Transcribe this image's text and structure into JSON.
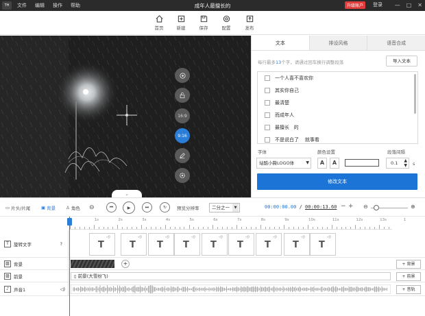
{
  "titlebar": {
    "logo": "TH",
    "menu": [
      "文件",
      "编辑",
      "操作",
      "帮助"
    ],
    "title": "成年人最擅长的",
    "upgrade": "升级账户",
    "login": "登录",
    "window_buttons": [
      "—",
      "□",
      "✕"
    ]
  },
  "toolbar": {
    "items": [
      {
        "label": "首页",
        "icon": "home-icon"
      },
      {
        "label": "新建",
        "icon": "new-file-icon"
      },
      {
        "label": "保存",
        "icon": "save-icon"
      },
      {
        "label": "配置",
        "icon": "settings-icon"
      },
      {
        "label": "发布",
        "icon": "publish-icon"
      }
    ]
  },
  "preview": {
    "controls": [
      {
        "name": "snap-control",
        "label": ""
      },
      {
        "name": "lock-control",
        "label": ""
      },
      {
        "name": "ratio-16-9",
        "label": "16:9"
      },
      {
        "name": "ratio-9-16",
        "label": "9:16"
      },
      {
        "name": "edit-control",
        "label": ""
      },
      {
        "name": "settings-control",
        "label": ""
      }
    ],
    "active_ratio": "9:16"
  },
  "panel": {
    "tabs": [
      "文本",
      "排设风格",
      "语音合成"
    ],
    "active_tab": "文本",
    "hint_prefix": "每行最多",
    "hint_num": "13",
    "hint_suffix": "个字，请通过回车换行调整段落",
    "import_label": "导入文本",
    "lines": [
      "一个人喜不喜欢你",
      "其实你自己",
      "最清楚",
      "而成年人",
      "最擅长   的",
      "不是说白了    就事看"
    ],
    "font_label": "字体",
    "font_value": "站酷小薇LOGO体",
    "color_label": "颜色设置",
    "spacing_label": "段落间隔",
    "spacing_value": "0.1",
    "spacing_unit": "s",
    "apply_label": "修改文本",
    "colors": {
      "accent": "#1c74d6"
    }
  },
  "controls": {
    "intro_label": "片头/片尾",
    "bg_label": "背景",
    "role_label": "角色",
    "resolution_label": "预览分辨率",
    "resolution_value": "二分之一",
    "time_current": "00:00:00.00",
    "time_sep": "/",
    "time_total": "00:00:13.60",
    "zoom_minus": "−",
    "zoom_plus": "+"
  },
  "timeline": {
    "ticks": [
      "1s",
      "2s",
      "3s",
      "4s",
      "5s",
      "6s",
      "7s",
      "8s",
      "9s",
      "10s",
      "11s",
      "12s",
      "13s",
      "1"
    ],
    "tracks": [
      {
        "name": "旋转文字",
        "add_label": ""
      },
      {
        "name": "背景",
        "add_label": "+ 背景"
      },
      {
        "name": "前景",
        "add_label": "+ 前景"
      },
      {
        "name": "声音1",
        "add_label": "+ 音轨"
      }
    ],
    "foreground_clip": "前景(大雪纷飞)",
    "text_clip_glyph": "T",
    "text_clip_sound": "◁)"
  }
}
